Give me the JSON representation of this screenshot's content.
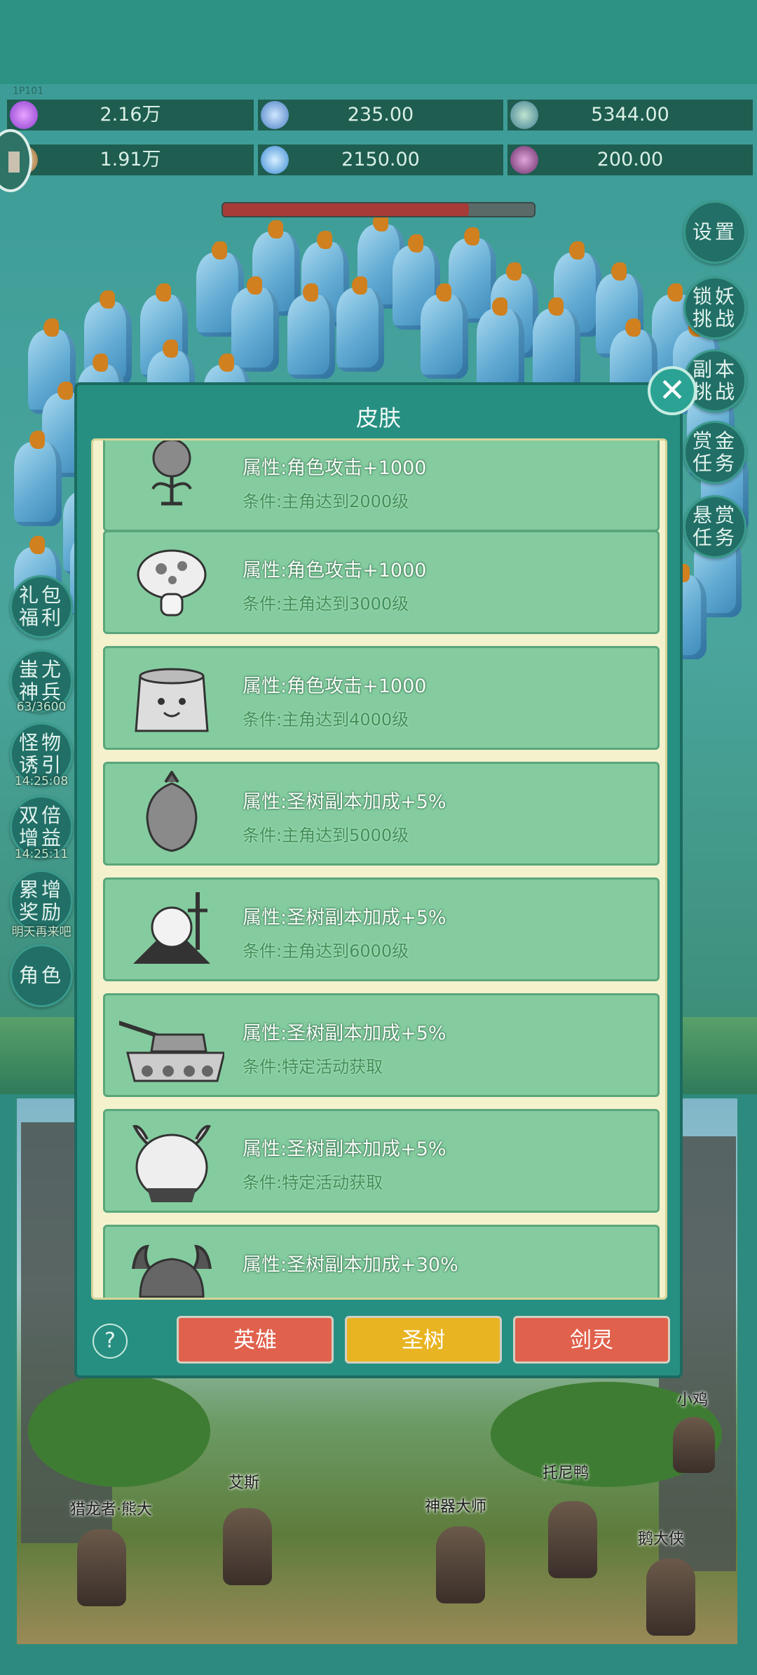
{
  "player_tag": "1P101",
  "resources": [
    {
      "icon": "purple-gem-icon",
      "value": "2.16万"
    },
    {
      "icon": "blue-orb-icon",
      "value": "235.00"
    },
    {
      "icon": "planet-orb-icon",
      "value": "5344.00"
    },
    {
      "icon": "scroll-icon",
      "value": "1.91万"
    },
    {
      "icon": "blue-crystal-icon",
      "value": "2150.00"
    },
    {
      "icon": "purple-pot-icon",
      "value": "200.00"
    }
  ],
  "boss_progress": 0.79,
  "right_buttons": [
    {
      "label": "设置"
    },
    {
      "label": "锁妖挑战"
    },
    {
      "label": "副本挑战"
    },
    {
      "label": "赏金任务"
    },
    {
      "label": "悬赏任务"
    }
  ],
  "left_buttons": [
    {
      "label": "礼包福利",
      "sub": ""
    },
    {
      "label": "蚩尤神兵",
      "sub": "63/3600"
    },
    {
      "label": "怪物诱引",
      "sub": "14:25:08"
    },
    {
      "label": "双倍增益",
      "sub": "14:25:11"
    },
    {
      "label": "累增奖励",
      "sub": "明天再来吧"
    },
    {
      "label": "角色",
      "sub": ""
    }
  ],
  "dialog": {
    "title": "皮肤",
    "close_icon": "close-icon",
    "skins": [
      {
        "thumb": "sprout-creature",
        "attr": "属性:角色攻击+1000",
        "cond": "条件:主角达到2000级"
      },
      {
        "thumb": "mushroom",
        "attr": "属性:角色攻击+1000",
        "cond": "条件:主角达到3000级"
      },
      {
        "thumb": "tree-stump",
        "attr": "属性:角色攻击+1000",
        "cond": "条件:主角达到4000级"
      },
      {
        "thumb": "carrot-creature",
        "attr": "属性:圣树副本加成+5%",
        "cond": "条件:主角达到5000级"
      },
      {
        "thumb": "chick-swordsman",
        "attr": "属性:圣树副本加成+5%",
        "cond": "条件:主角达到6000级"
      },
      {
        "thumb": "tank",
        "attr": "属性:圣树副本加成+5%",
        "cond": "条件:特定活动获取"
      },
      {
        "thumb": "cow-warrior",
        "attr": "属性:圣树副本加成+5%",
        "cond": "条件:特定活动获取"
      },
      {
        "thumb": "horned-helmet",
        "attr": "属性:圣树副本加成+30%",
        "cond": ""
      }
    ],
    "help_label": "?",
    "tabs": [
      {
        "label": "英雄",
        "color": "#e0614c"
      },
      {
        "label": "圣树",
        "color": "#e8b422",
        "selected": true
      },
      {
        "label": "剑灵",
        "color": "#e0614c"
      }
    ]
  },
  "heroes": [
    "猎龙者·熊大",
    "艾斯",
    "神器大师",
    "托尼鸭",
    "鹅大侠",
    "小鸡"
  ]
}
